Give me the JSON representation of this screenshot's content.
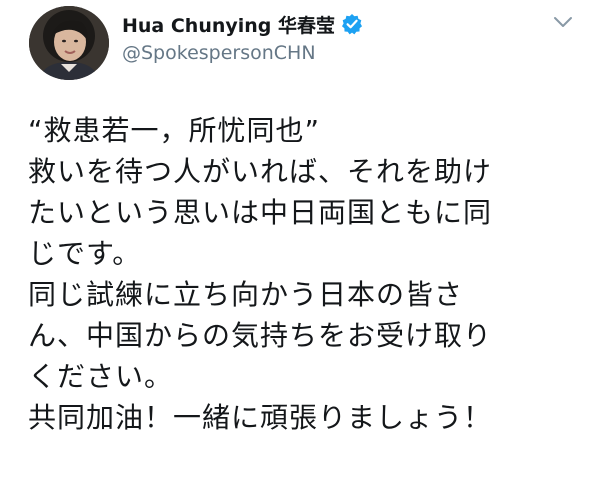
{
  "user": {
    "display_name": "Hua Chunying 华春莹",
    "handle": "@SpokespersonCHN"
  },
  "icons": {
    "avatar": "profile-photo",
    "verified": "verified-badge-icon",
    "menu": "chevron-down-icon"
  },
  "colors": {
    "verified_blue": "#1da1f2",
    "handle_gray": "#657786",
    "text": "#14171a"
  },
  "tweet": {
    "lines": [
      "“救患若一，所忧同也”",
      "救いを待つ人がいれば、それを助け",
      "たいという思いは中日両国ともに同",
      "じです。",
      "同じ試練に立ち向かう日本の皆さ",
      "ん、中国からの気持ちをお受け取り",
      "ください。",
      "共同加油！一緒に頑張りましょう！"
    ]
  }
}
